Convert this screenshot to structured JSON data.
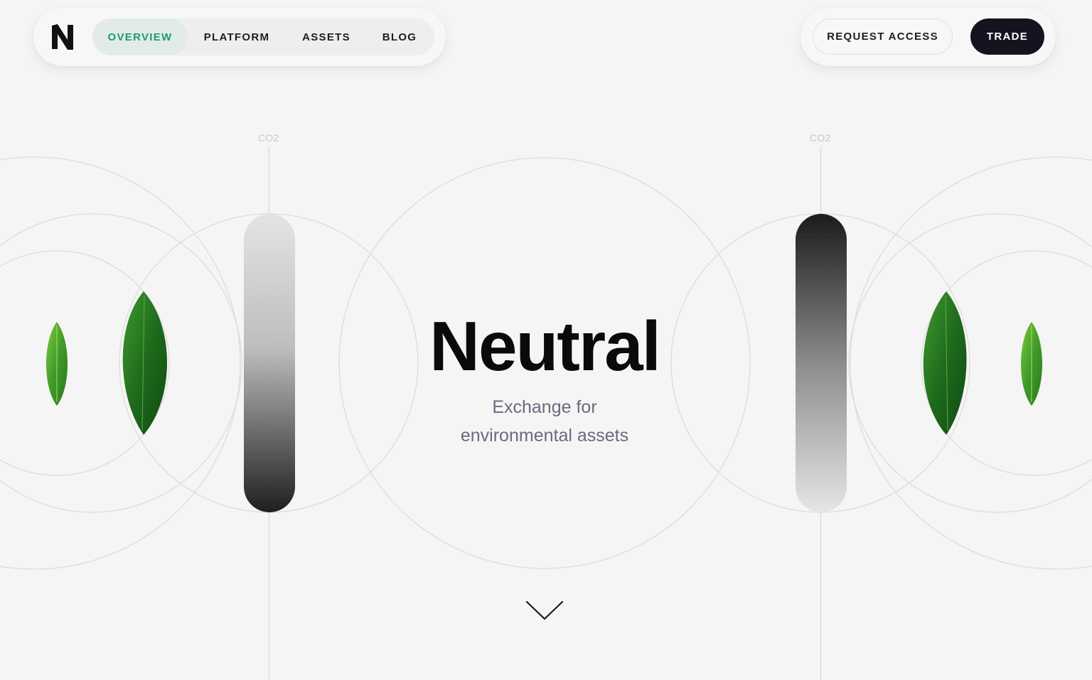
{
  "nav": {
    "logo_letter": "N",
    "items": [
      {
        "label": "OVERVIEW",
        "active": true
      },
      {
        "label": "PLATFORM",
        "active": false
      },
      {
        "label": "ASSETS",
        "active": false
      },
      {
        "label": "BLOG",
        "active": false
      }
    ],
    "request_access_label": "REQUEST ACCESS",
    "trade_label": "TRADE"
  },
  "hero": {
    "title": "Neutral",
    "subtitle_line1": "Exchange for",
    "subtitle_line2": "environmental assets"
  },
  "labels": {
    "co2_left": "CO2",
    "co2_right": "CO2"
  },
  "colors": {
    "accent_green": "#1f9a72",
    "dark_button": "#141420",
    "background": "#f5f5f5",
    "subtitle": "#6a6a80"
  },
  "icons": {
    "scroll": "chevron-down-icon",
    "logo": "n-logo-icon"
  }
}
